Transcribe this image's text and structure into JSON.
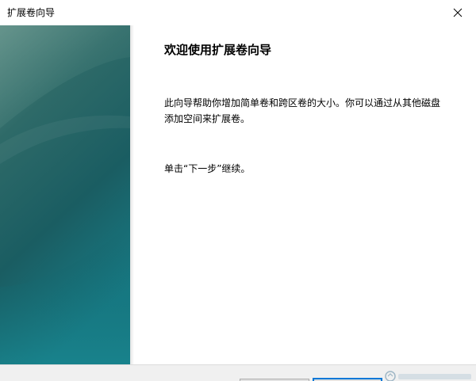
{
  "window": {
    "title": "扩展卷向导",
    "close_icon": "close-icon"
  },
  "wizard": {
    "heading": "欢迎使用扩展卷向导",
    "description": "此向导帮助你增加简单卷和跨区卷的大小。你可以通过从其他磁盘添加空间来扩展卷。",
    "continue_text": "单击“下一步”继续。"
  },
  "colors": {
    "side_panel_top": "#4a7a74",
    "side_panel_mid": "#1a5a5e",
    "side_panel_bottom": "#16777f"
  }
}
